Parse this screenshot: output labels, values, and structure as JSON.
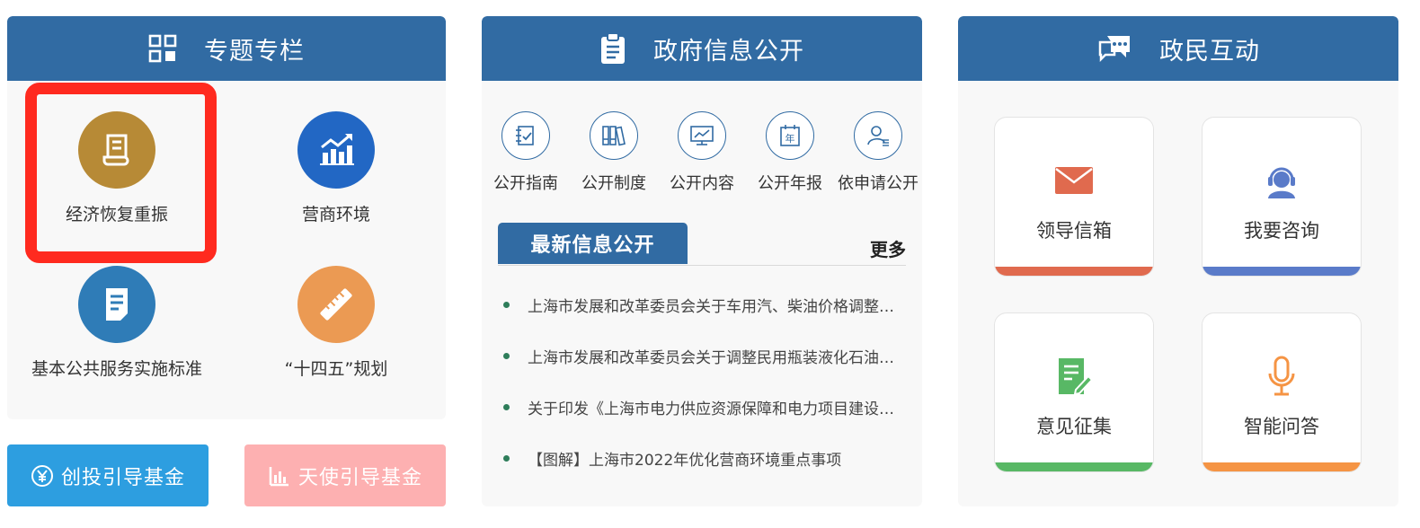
{
  "special_topics": {
    "title": "专题专栏",
    "items": [
      {
        "label": "经济恢复重振",
        "color": "#b78a36",
        "icon": "scroll-icon"
      },
      {
        "label": "营商环境",
        "color": "#2267c4",
        "icon": "chart-growth-icon"
      },
      {
        "label": "基本公共服务实施标准",
        "color": "#2f7cb7",
        "icon": "document-icon"
      },
      {
        "label": "“十四五”规划",
        "color": "#eb9a53",
        "icon": "ruler-pencil-icon"
      }
    ],
    "funds": [
      {
        "label": "创投引导基金",
        "color": "#2d9ee0",
        "icon": "yen-coin-icon"
      },
      {
        "label": "天使引导基金",
        "color": "#fdb0b1",
        "icon": "bar-chart-icon"
      }
    ]
  },
  "gov_info": {
    "title": "政府信息公开",
    "items": [
      {
        "label": "公开指南",
        "icon": "guide-icon"
      },
      {
        "label": "公开制度",
        "icon": "binders-icon"
      },
      {
        "label": "公开内容",
        "icon": "monitor-chart-icon"
      },
      {
        "label": "公开年报",
        "icon": "calendar-year-icon"
      },
      {
        "label": "依申请公开",
        "icon": "user-list-icon"
      }
    ],
    "news_tab": "最新信息公开",
    "more": "更多",
    "news": [
      "上海市发展和改革委员会关于车用汽、柴油价格调整的通知",
      "上海市发展和改革委员会关于调整民用瓶装液化石油气价格的通知",
      "关于印发《上海市电力供应资源保障和电力项目建设方案》的通知",
      "【图解】上海市2022年优化营商环境重点事项"
    ]
  },
  "interaction": {
    "title": "政民互动",
    "cards": [
      {
        "label": "领导信箱",
        "color": "#e06a4e",
        "icon": "mail-icon"
      },
      {
        "label": "我要咨询",
        "color": "#5a7bc9",
        "icon": "headset-agent-icon"
      },
      {
        "label": "意见征集",
        "color": "#58b865",
        "icon": "feedback-form-icon"
      },
      {
        "label": "智能问答",
        "color": "#f59444",
        "icon": "microphone-icon"
      }
    ]
  }
}
